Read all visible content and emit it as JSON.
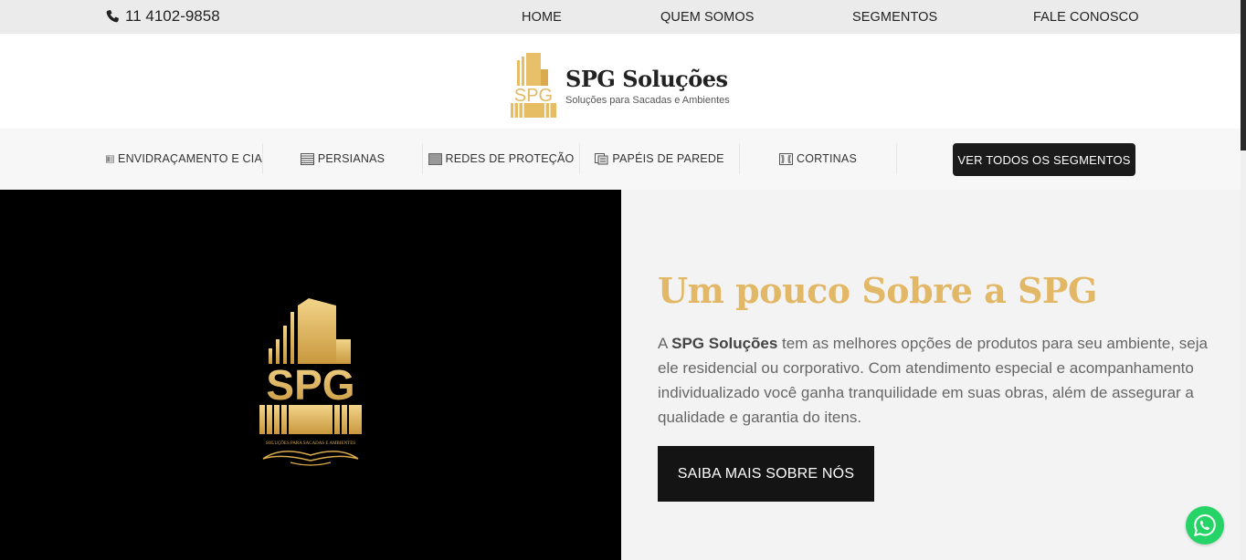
{
  "topbar": {
    "phone": "11 4102-9858",
    "nav": [
      "HOME",
      "QUEM SOMOS",
      "SEGMENTOS",
      "FALE CONOSCO"
    ]
  },
  "brand": {
    "name": "SPG Soluções",
    "tagline": "Soluções para Sacadas e Ambientes",
    "logo_text": "SPG",
    "hero_logo_small_text": "SOLUÇÕES PARA SACADAS E AMBIENTES"
  },
  "segments": {
    "items": [
      {
        "label": "ENVIDRAÇAMENTO E CIA",
        "icon": "window-icon"
      },
      {
        "label": "PERSIANAS",
        "icon": "blinds-icon"
      },
      {
        "label": "REDES DE PROTEÇÃO",
        "icon": "net-icon"
      },
      {
        "label": "PAPÉIS DE PAREDE",
        "icon": "wallpaper-icon"
      },
      {
        "label": "CORTINAS",
        "icon": "curtain-icon"
      }
    ],
    "all_button": "VER TODOS OS SEGMENTOS"
  },
  "about": {
    "title": "Um pouco Sobre a SPG",
    "text_prefix": "A ",
    "text_brand": "SPG Soluções",
    "text_body": " tem as melhores opções de produtos para seu ambiente, seja ele residencial ou corporativo. Com atendimento especial e acompanhamento individualizado você ganha tranquilidade em suas obras, além de assegurar a qualidade e garantia do itens.",
    "button": "SAIBA MAIS SOBRE NÓS"
  },
  "colors": {
    "gold": "#e2b866",
    "dark": "#141414",
    "whatsapp": "#25d366"
  }
}
